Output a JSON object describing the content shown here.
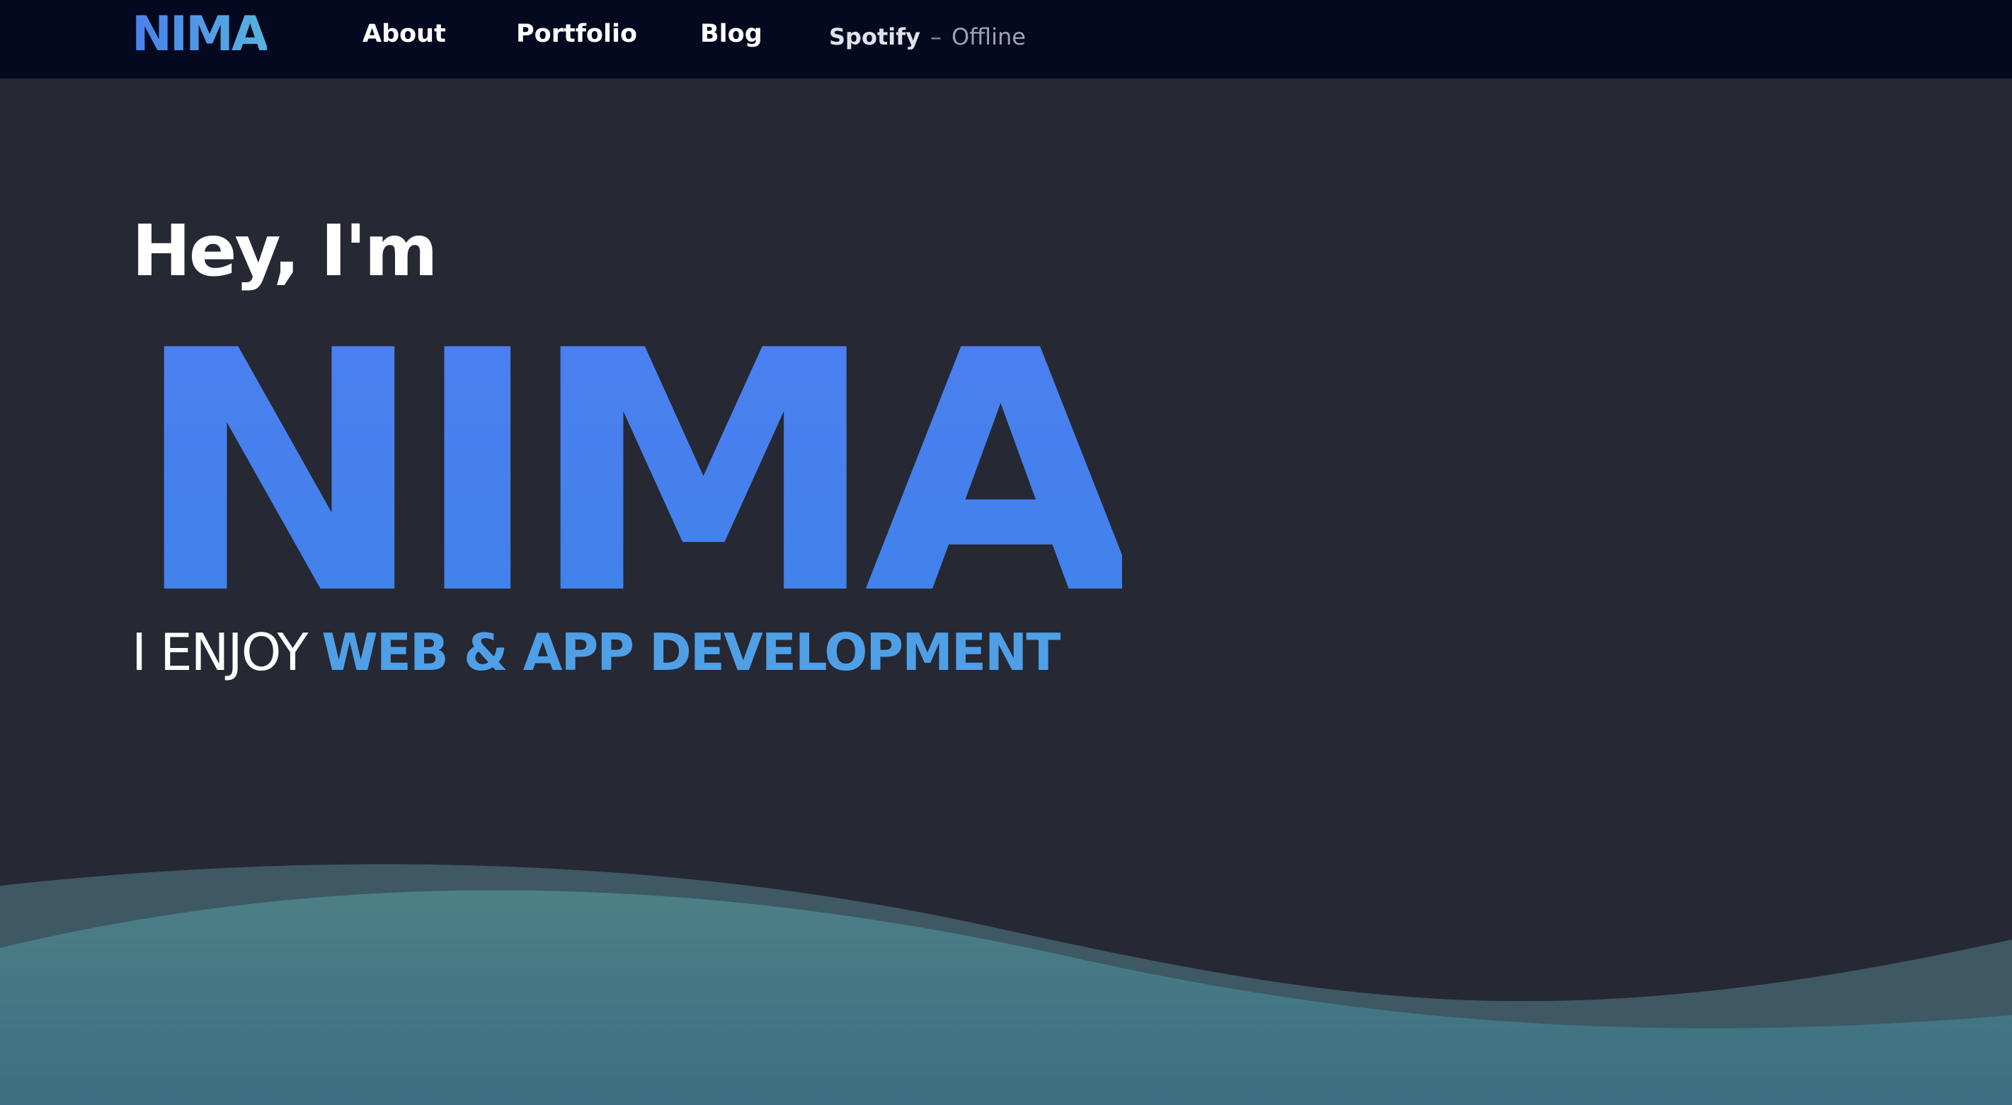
{
  "header": {
    "logo": "NIMA",
    "nav": [
      {
        "label": "About"
      },
      {
        "label": "Portfolio"
      },
      {
        "label": "Blog"
      }
    ],
    "spotify": {
      "label": "Spotify",
      "separator": "–",
      "status": "Offline"
    }
  },
  "hero": {
    "greeting": "Hey, I'm",
    "name": "NIMA",
    "tagline_prefix": "I ENJOY",
    "tagline_highlight": "WEB & APP DEVELOPMENT"
  },
  "colors": {
    "nav_background": "#040920",
    "page_background": "#262834",
    "accent_blue": "#4281ec",
    "highlight_blue": "#4f9fe6",
    "wave_back": "#3e5964",
    "wave_front": "#3f7583"
  }
}
